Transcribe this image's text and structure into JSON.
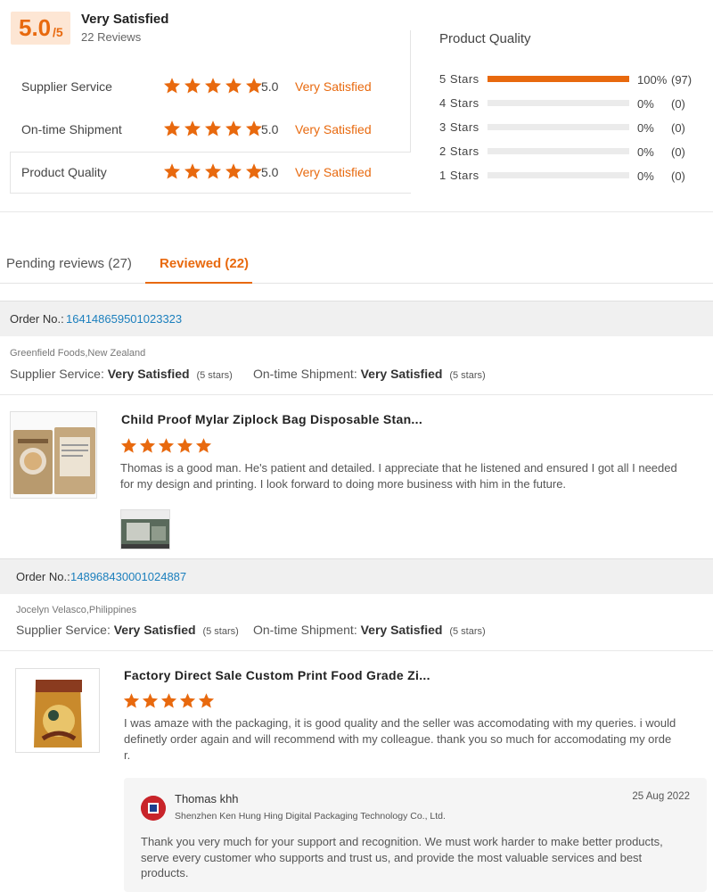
{
  "summary": {
    "score": "5.0",
    "score_max": "/5",
    "overall_label": "Very Satisfied",
    "review_count": "22 Reviews",
    "dimensions": [
      {
        "label": "Supplier Service",
        "score": "5.0",
        "word": "Very Satisfied",
        "stars": 5
      },
      {
        "label": "On-time Shipment",
        "score": "5.0",
        "word": "Very Satisfied",
        "stars": 5
      },
      {
        "label": "Product Quality",
        "score": "5.0",
        "word": "Very Satisfied",
        "stars": 5,
        "active": true
      }
    ]
  },
  "product_quality": {
    "title": "Product Quality",
    "rows": [
      {
        "label": "5 Stars",
        "fraction": 1.0,
        "percent": "100%",
        "count": "(97)"
      },
      {
        "label": "4 Stars",
        "fraction": 0,
        "percent": "0%",
        "count": "(0)"
      },
      {
        "label": "3 Stars",
        "fraction": 0,
        "percent": "0%",
        "count": "(0)"
      },
      {
        "label": "2 Stars",
        "fraction": 0,
        "percent": "0%",
        "count": "(0)"
      },
      {
        "label": "1 Stars",
        "fraction": 0,
        "percent": "0%",
        "count": "(0)"
      }
    ]
  },
  "tabs": [
    {
      "label": "Pending reviews (27)",
      "active": false
    },
    {
      "label": "Reviewed (22)",
      "active": true
    }
  ],
  "orders": [
    {
      "order_label": "Order No.:",
      "order_no": "164148659501023323",
      "buyer": "Greenfield Foods,New Zealand",
      "supplier_label": "Supplier Service:",
      "supplier_value": "Very Satisfied",
      "supplier_stars": "(5 stars)",
      "shipment_label": "On-time Shipment:",
      "shipment_value": "Very Satisfied",
      "shipment_stars": "(5 stars)",
      "product_title": "Child Proof Mylar Ziplock Bag Disposable Stan...",
      "stars": 5,
      "review": "Thomas is a good man. He's patient and detailed. I appreciate that he listened and ensured I got all I needed for my design and printing. I look forward to doing more business with him in the future.",
      "has_photo": true
    },
    {
      "order_label": "Order No.:",
      "order_no": "148968430001024887",
      "buyer": "Jocelyn Velasco,Philippines",
      "supplier_label": "Supplier Service:",
      "supplier_value": "Very Satisfied",
      "supplier_stars": "(5 stars)",
      "shipment_label": "On-time Shipment:",
      "shipment_value": "Very Satisfied",
      "shipment_stars": "(5 stars)",
      "product_title": "Factory Direct Sale Custom Print Food Grade Zi...",
      "stars": 5,
      "review": "I was amaze with the packaging, it is good quality and the seller was accomodating with my queries. i would definetly order again and will recommend with my colleague. thank you so much for accomodating my order.",
      "reply": {
        "name": "Thomas khh",
        "company": "Shenzhen Ken Hung Hing Digital Packaging Technology Co., Ltd.",
        "date": "25 Aug 2022",
        "text": "Thank you very much for your support and recognition. We must work harder to make better products, serve every customer who supports and trust us, and provide the most valuable services and best products."
      }
    }
  ],
  "colors": {
    "accent": "#e8690e",
    "link": "#1b7fbd",
    "badge_bg": "#fde6d4"
  }
}
